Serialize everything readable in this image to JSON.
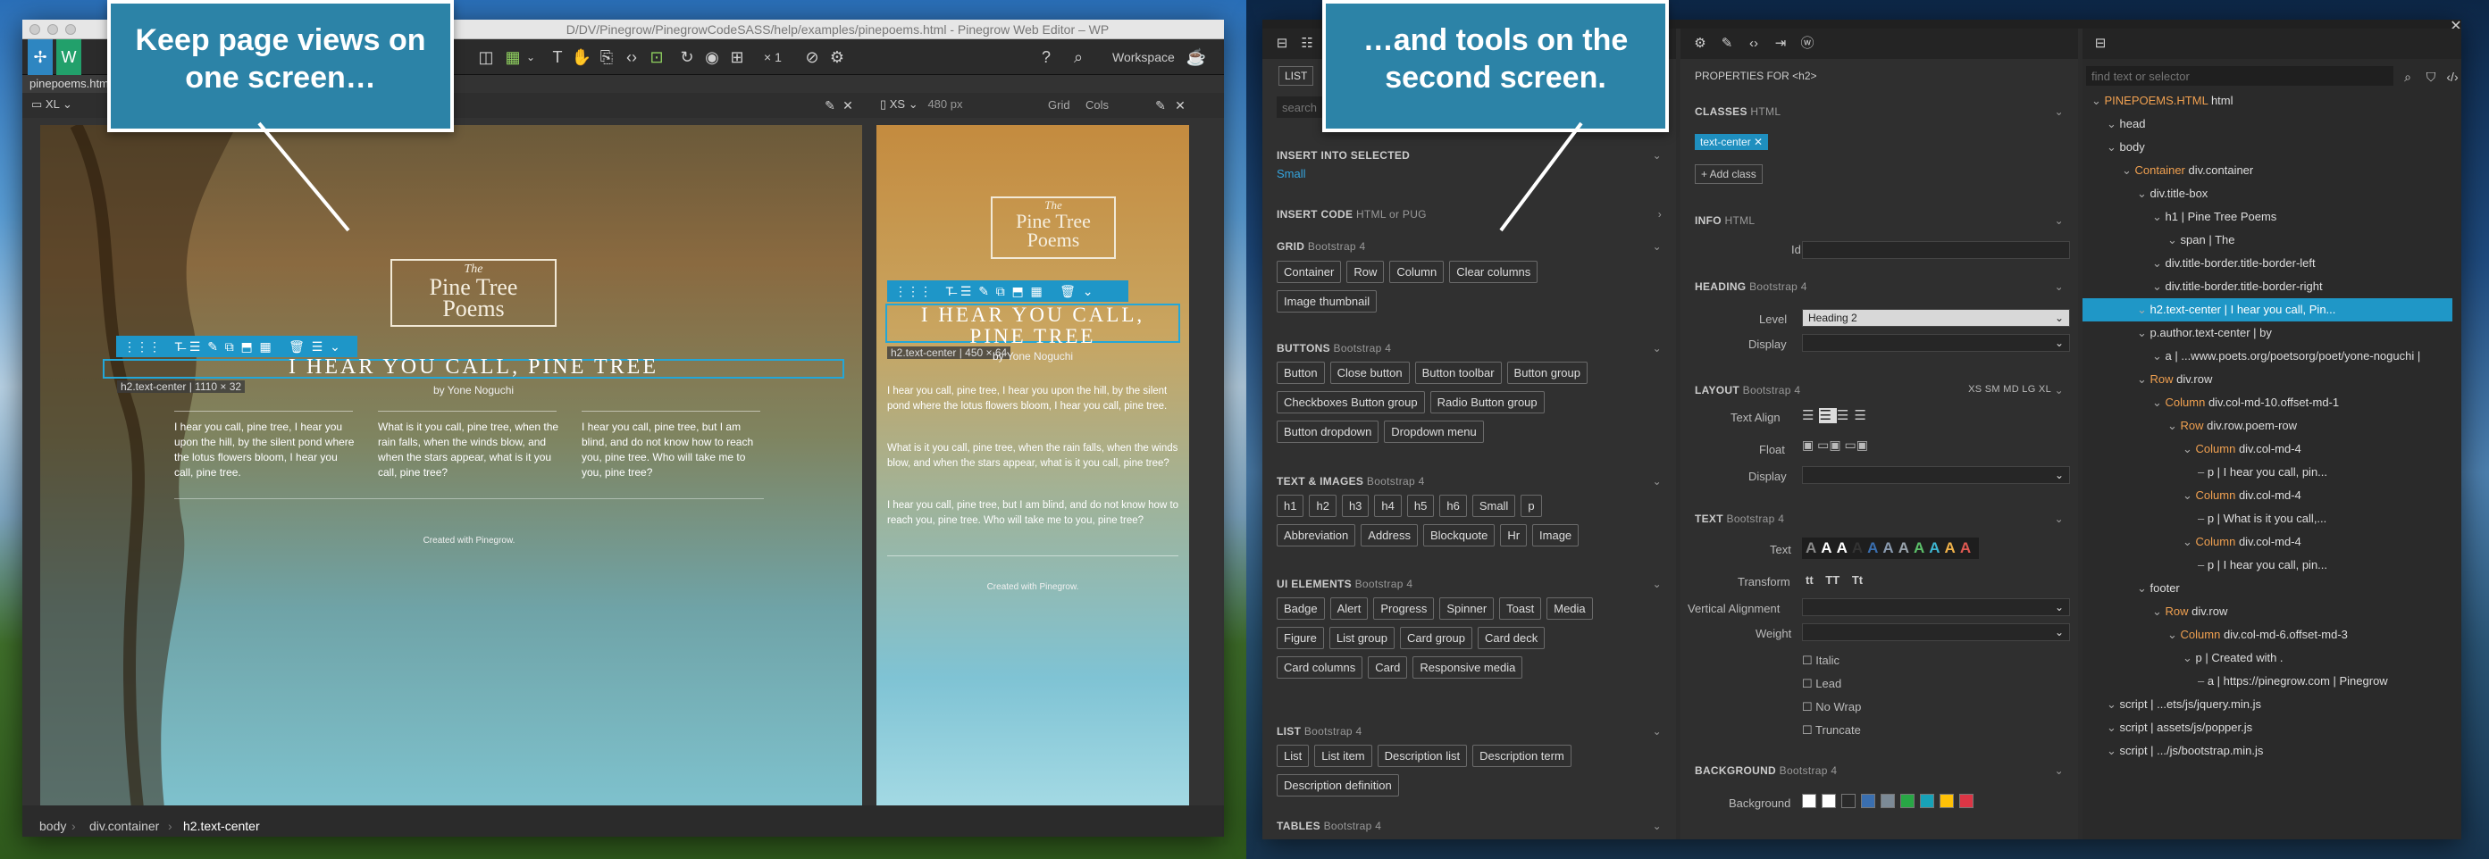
{
  "callouts": {
    "left": "Keep page views on one screen…",
    "right": "…and tools on the second screen."
  },
  "editor": {
    "window_title": "D/DV/Pinegrow/PinegrowCodeSASS/help/examples/pinepoems.html - Pinegrow Web Editor – WP",
    "tab_name": "pinepoems.html",
    "multiplier": "× 1",
    "workspace_label": "Workspace",
    "left_view": {
      "size": "XL"
    },
    "right_view": {
      "size": "XS",
      "width": "480 px",
      "grid": "Grid",
      "cols": "Cols"
    },
    "page": {
      "logo_the": "The",
      "logo_line1": "Pine Tree",
      "logo_line2": "Poems",
      "heading": "I HEAR YOU CALL, PINE TREE",
      "heading_mobile_1": "I HEAR YOU CALL,",
      "heading_mobile_2": "PINE TREE",
      "author": "by Yone Noguchi",
      "sel_label_desktop": "h2.text-center | 1110 × 32",
      "sel_label_mobile": "h2.text-center | 450 × 64",
      "p1": "I hear you call, pine tree, I hear you upon the hill, by the silent pond where the lotus flowers bloom, I hear you call, pine tree.",
      "p2": "What is it you call, pine tree, when the rain falls, when the winds blow, and when the stars appear, what is it you call, pine tree?",
      "p3": "I hear you call, pine tree, but I am blind, and do not know how to reach you, pine tree. Who will take me to you, pine tree?",
      "footer": "Created with Pinegrow."
    },
    "breadcrumb": [
      "body",
      "div.container",
      "h2.text-center"
    ]
  },
  "library": {
    "tab": "LIST",
    "search_placeholder": "search",
    "insert_into": "INSERT INTO SELECTED",
    "insert_into_value": "Small",
    "insert_code": "INSERT CODE",
    "insert_code_sub": "HTML or PUG",
    "sections": [
      {
        "title": "GRID",
        "sub": "Bootstrap 4",
        "items": [
          "Container",
          "Row",
          "Column",
          "Clear columns",
          "Image thumbnail"
        ]
      },
      {
        "title": "BUTTONS",
        "sub": "Bootstrap 4",
        "items": [
          "Button",
          "Close button",
          "Button toolbar",
          "Button group",
          "Checkboxes Button group",
          "Radio Button group",
          "Button dropdown",
          "Dropdown menu"
        ]
      },
      {
        "title": "TEXT & IMAGES",
        "sub": "Bootstrap 4",
        "items": [
          "h1",
          "h2",
          "h3",
          "h4",
          "h5",
          "h6",
          "Small",
          "p",
          "Abbreviation",
          "Address",
          "Blockquote",
          "Hr",
          "Image"
        ]
      },
      {
        "title": "UI ELEMENTS",
        "sub": "Bootstrap 4",
        "items": [
          "Badge",
          "Alert",
          "Progress",
          "Spinner",
          "Toast",
          "Media",
          "Figure",
          "List group",
          "Card group",
          "Card deck",
          "Card columns",
          "Card",
          "Responsive media"
        ]
      },
      {
        "title": "LIST",
        "sub": "Bootstrap 4",
        "items": [
          "List",
          "List item",
          "Description list",
          "Description term",
          "Description definition"
        ]
      },
      {
        "title": "TABLES",
        "sub": "Bootstrap 4",
        "items": []
      }
    ]
  },
  "properties": {
    "title": "PROPERTIES FOR <h2>",
    "classes_title": "CLASSES",
    "classes_sub": "HTML",
    "class_tag": "text-center",
    "add_class": "+ Add class",
    "info_title": "INFO",
    "info_sub": "HTML",
    "id_label": "Id",
    "heading_title": "HEADING",
    "heading_sub": "Bootstrap 4",
    "level_label": "Level",
    "level_value": "Heading 2",
    "display_label": "Display",
    "layout_title": "LAYOUT",
    "layout_sub": "Bootstrap 4",
    "breakpoints": "XS SM MD LG XL",
    "text_align_label": "Text Align",
    "float_label": "Float",
    "display2_label": "Display",
    "text_title": "TEXT",
    "text_sub": "Bootstrap 4",
    "text_label": "Text",
    "transform_label": "Transform",
    "transform_values": [
      "tt",
      "TT",
      "Tt"
    ],
    "valign_label": "Vertical Alignment",
    "weight_label": "Weight",
    "checkboxes": [
      "Italic",
      "Lead",
      "No Wrap",
      "Truncate"
    ],
    "background_title": "BACKGROUND",
    "background_sub": "Bootstrap 4",
    "background_label": "Background",
    "text_colors": [
      "#8a8a8a",
      "#ffffff",
      "#ffffff",
      "#333333",
      "#3a6fb0",
      "#8a9bb0",
      "#9aa4ad",
      "#5cc06a",
      "#3eb6d2",
      "#f0b24a",
      "#e05a52"
    ],
    "bg_colors": [
      "#ffffff",
      "#ffffff",
      "#2a2a2a",
      "#3a6fb0",
      "#7c8a96",
      "#28a745",
      "#17a2b8",
      "#ffc107",
      "#dc3545"
    ]
  },
  "tree": {
    "search_placeholder": "find text or selector",
    "items": [
      {
        "text": "PINEPOEMS.HTML html",
        "indent": 0,
        "accent": true
      },
      {
        "text": "head",
        "indent": 1
      },
      {
        "text": "body",
        "indent": 1
      },
      {
        "text": "Container div.container",
        "indent": 2
      },
      {
        "text": "div.title-box",
        "indent": 3
      },
      {
        "text": "h1 | Pine Tree Poems",
        "indent": 4
      },
      {
        "text": "span | The",
        "indent": 5
      },
      {
        "text": "div.title-border.title-border-left",
        "indent": 4
      },
      {
        "text": "div.title-border.title-border-right",
        "indent": 4
      },
      {
        "text": "h2.text-center | I hear you call, Pin...",
        "indent": 3,
        "selected": true
      },
      {
        "text": "p.author.text-center | by",
        "indent": 3
      },
      {
        "text": "a | ...www.poets.org/poetsorg/poet/yone-noguchi |",
        "indent": 4
      },
      {
        "text": "Row div.row",
        "indent": 3
      },
      {
        "text": "Column div.col-md-10.offset-md-1",
        "indent": 4
      },
      {
        "text": "Row div.row.poem-row",
        "indent": 5
      },
      {
        "text": "Column div.col-md-4",
        "indent": 6
      },
      {
        "text": "p | I hear you call, pin...",
        "indent": 7
      },
      {
        "text": "Column div.col-md-4",
        "indent": 6
      },
      {
        "text": "p | What is it you call,...",
        "indent": 7
      },
      {
        "text": "Column div.col-md-4",
        "indent": 6
      },
      {
        "text": "p | I hear you call, pin...",
        "indent": 7
      },
      {
        "text": "footer",
        "indent": 3
      },
      {
        "text": "Row div.row",
        "indent": 4
      },
      {
        "text": "Column div.col-md-6.offset-md-3",
        "indent": 5
      },
      {
        "text": "p | Created with .",
        "indent": 6
      },
      {
        "text": "a | https://pinegrow.com | Pinegrow",
        "indent": 7
      },
      {
        "text": "script | ...ets/js/jquery.min.js",
        "indent": 1
      },
      {
        "text": "script | assets/js/popper.js",
        "indent": 1
      },
      {
        "text": "script | .../js/bootstrap.min.js",
        "indent": 1
      }
    ]
  }
}
